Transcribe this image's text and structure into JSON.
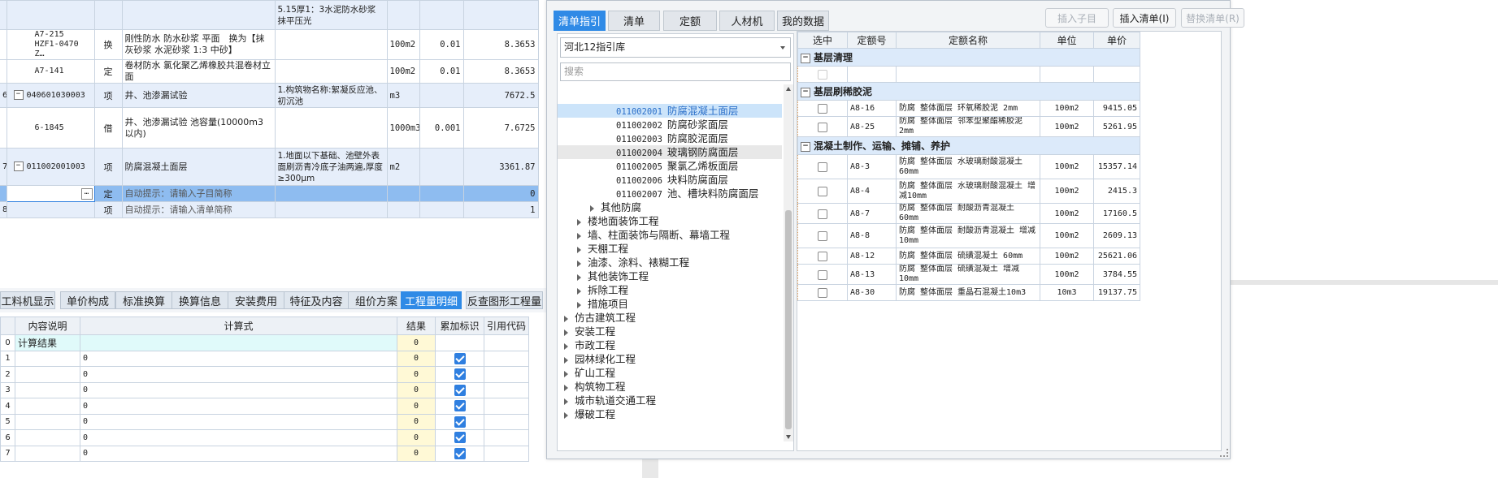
{
  "top_table": {
    "rows": [
      {
        "idx": "",
        "code": "",
        "type": "",
        "name": "",
        "feature": "5.15厚1：3水泥防水砂浆抹平压光",
        "unit": "",
        "qty": "",
        "price": ""
      },
      {
        "idx": "",
        "code": "A7-215\nHZF1-0470 Z…",
        "type": "换",
        "name": "刚性防水 防水砂浆 平面　换为【抹灰砂浆 水泥砂浆 1:3 中砂】",
        "feature": "",
        "unit": "100m2",
        "qty": "0.01",
        "price": "8.3653"
      },
      {
        "idx": "",
        "code": "A7-141",
        "type": "定",
        "name": "卷材防水 氯化聚乙烯橡胶共混卷材立面",
        "feature": "",
        "unit": "100m2",
        "qty": "0.01",
        "price": "8.3653"
      },
      {
        "idx": "6",
        "code": "040601030003",
        "type": "项",
        "name": "井、池渗漏试验",
        "feature": "1.构筑物名称:絮凝反应池、初沉池",
        "unit": "m3",
        "qty": "",
        "price": "7672.5"
      },
      {
        "idx": "",
        "code": "6-1845",
        "type": "借",
        "name": "井、池渗漏试验 池容量(10000m3以内)",
        "feature": "",
        "unit": "1000m3",
        "qty": "0.001",
        "price": "7.6725"
      },
      {
        "idx": "7",
        "code": "011002001003",
        "type": "项",
        "name": "防腐混凝土面层",
        "feature": "1.地面以下基础、池壁外表面刷沥青冷底子油两遍,厚度≥300μm",
        "unit": "m2",
        "qty": "",
        "price": "3361.87"
      },
      {
        "idx": "",
        "code": "",
        "type": "定",
        "name": "自动提示：请输入子目简称",
        "feature": "",
        "unit": "",
        "qty": "",
        "price": "0"
      },
      {
        "idx": "8",
        "code": "",
        "type": "项",
        "name": "自动提示：请输入清单简称",
        "feature": "",
        "unit": "",
        "qty": "",
        "price": "1"
      }
    ]
  },
  "bottom_tabs": [
    "工料机显示",
    "单价构成",
    "标准换算",
    "换算信息",
    "安装费用",
    "特征及内容",
    "组价方案",
    "工程量明细",
    "反查图形工程量"
  ],
  "bottom_table": {
    "headers": [
      "内容说明",
      "计算式",
      "结果",
      "累加标识",
      "引用代码"
    ],
    "rows": [
      {
        "n": "0",
        "desc": "计算结果",
        "formula": "",
        "result": "0",
        "check": false
      },
      {
        "n": "1",
        "desc": "",
        "formula": "0",
        "result": "0",
        "check": true
      },
      {
        "n": "2",
        "desc": "",
        "formula": "0",
        "result": "0",
        "check": true
      },
      {
        "n": "3",
        "desc": "",
        "formula": "0",
        "result": "0",
        "check": true
      },
      {
        "n": "4",
        "desc": "",
        "formula": "0",
        "result": "0",
        "check": true
      },
      {
        "n": "5",
        "desc": "",
        "formula": "0",
        "result": "0",
        "check": true
      },
      {
        "n": "6",
        "desc": "",
        "formula": "0",
        "result": "0",
        "check": true
      },
      {
        "n": "7",
        "desc": "",
        "formula": "0",
        "result": "0",
        "check": true
      }
    ]
  },
  "panel": {
    "tabs": [
      "清单指引",
      "清单",
      "定额",
      "人材机",
      "我的数据"
    ],
    "buttons": {
      "insert_sub": "插入子目",
      "insert_list": "插入清单(I)",
      "replace_list": "替换清单(R)"
    },
    "library": "河北12指引库",
    "search_placeholder": "搜索",
    "tree": [
      {
        "code": "011002001",
        "name": "防腐混凝土面层",
        "level": 3,
        "state": "selected"
      },
      {
        "code": "011002002",
        "name": "防腐砂浆面层",
        "level": 3,
        "state": ""
      },
      {
        "code": "011002003",
        "name": "防腐胶泥面层",
        "level": 3,
        "state": ""
      },
      {
        "code": "011002004",
        "name": "玻璃钢防腐面层",
        "level": 3,
        "state": "hover"
      },
      {
        "code": "011002005",
        "name": "聚氯乙烯板面层",
        "level": 3,
        "state": ""
      },
      {
        "code": "011002006",
        "name": "块料防腐面层",
        "level": 3,
        "state": ""
      },
      {
        "code": "011002007",
        "name": "池、槽块料防腐面层",
        "level": 3,
        "state": ""
      },
      {
        "code": "",
        "name": "其他防腐",
        "level": 2,
        "state": ""
      },
      {
        "code": "",
        "name": "楼地面装饰工程",
        "level": 1,
        "state": ""
      },
      {
        "code": "",
        "name": "墙、柱面装饰与隔断、幕墙工程",
        "level": 1,
        "state": ""
      },
      {
        "code": "",
        "name": "天棚工程",
        "level": 1,
        "state": ""
      },
      {
        "code": "",
        "name": "油漆、涂料、裱糊工程",
        "level": 1,
        "state": ""
      },
      {
        "code": "",
        "name": "其他装饰工程",
        "level": 1,
        "state": ""
      },
      {
        "code": "",
        "name": "拆除工程",
        "level": 1,
        "state": ""
      },
      {
        "code": "",
        "name": "措施项目",
        "level": 1,
        "state": ""
      },
      {
        "code": "",
        "name": "仿古建筑工程",
        "level": 0,
        "state": ""
      },
      {
        "code": "",
        "name": "安装工程",
        "level": 0,
        "state": ""
      },
      {
        "code": "",
        "name": "市政工程",
        "level": 0,
        "state": ""
      },
      {
        "code": "",
        "name": "园林绿化工程",
        "level": 0,
        "state": ""
      },
      {
        "code": "",
        "name": "矿山工程",
        "level": 0,
        "state": ""
      },
      {
        "code": "",
        "name": "构筑物工程",
        "level": 0,
        "state": ""
      },
      {
        "code": "",
        "name": "城市轨道交通工程",
        "level": 0,
        "state": ""
      },
      {
        "code": "",
        "name": "爆破工程",
        "level": 0,
        "state": ""
      }
    ],
    "quota_headers": [
      "选中",
      "定额号",
      "定额名称",
      "单位",
      "单价"
    ],
    "quota_groups": [
      {
        "title": "基层清理",
        "items": [
          {
            "code": "",
            "name": "",
            "unit": "",
            "price": "",
            "blank": true
          }
        ]
      },
      {
        "title": "基层刷稀胶泥",
        "items": [
          {
            "code": "A8-16",
            "name": "防腐 整体面层 环氧稀胶泥 2mm",
            "unit": "100m2",
            "price": "9415.05"
          },
          {
            "code": "A8-25",
            "name": "防腐 整体面层 邻苯型聚酯稀胶泥 2mm",
            "unit": "100m2",
            "price": "5261.95"
          }
        ]
      },
      {
        "title": "混凝土制作、运输、摊铺、养护",
        "items": [
          {
            "code": "A8-3",
            "name": "防腐 整体面层 水玻璃耐酸混凝土 60mm",
            "unit": "100m2",
            "price": "15357.14"
          },
          {
            "code": "A8-4",
            "name": "防腐 整体面层 水玻璃耐酸混凝土 增减10mm",
            "unit": "100m2",
            "price": "2415.3"
          },
          {
            "code": "A8-7",
            "name": "防腐 整体面层 耐酸沥青混凝土 60mm",
            "unit": "100m2",
            "price": "17160.5"
          },
          {
            "code": "A8-8",
            "name": "防腐 整体面层 耐酸沥青混凝土 增减10mm",
            "unit": "100m2",
            "price": "2609.13"
          },
          {
            "code": "A8-12",
            "name": "防腐 整体面层 硫磺混凝土 60mm",
            "unit": "100m2",
            "price": "25621.06"
          },
          {
            "code": "A8-13",
            "name": "防腐 整体面层 硫磺混凝土 增减10mm",
            "unit": "100m2",
            "price": "3784.55"
          },
          {
            "code": "A8-30",
            "name": "防腐 整体面层 重晶石混凝土10m3",
            "unit": "10m3",
            "price": "19137.75"
          }
        ]
      }
    ]
  }
}
